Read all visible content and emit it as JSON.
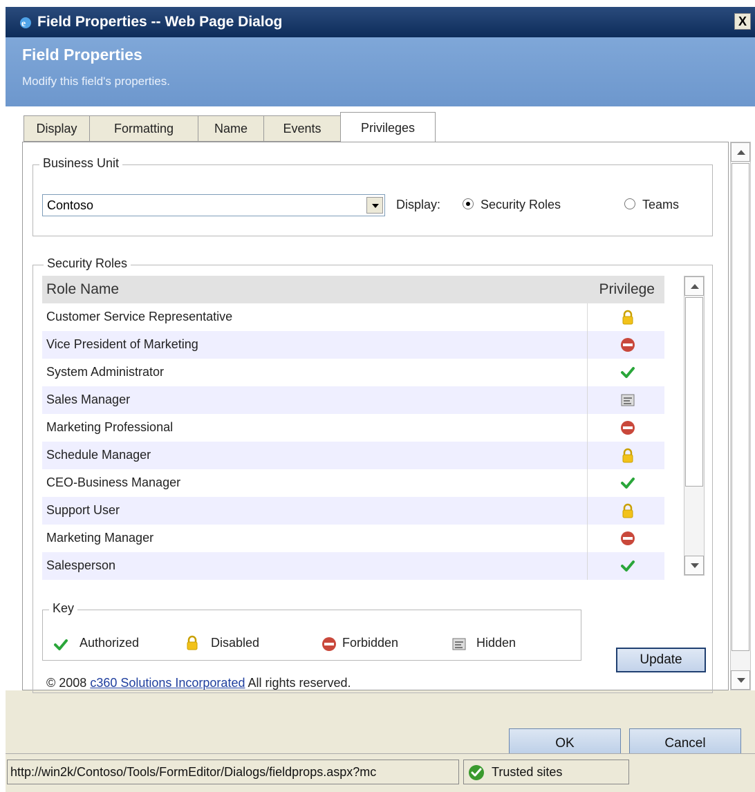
{
  "window": {
    "title": "Field Properties -- Web Page Dialog",
    "close_label": "X"
  },
  "header": {
    "title": "Field Properties",
    "subtitle": "Modify this field's properties."
  },
  "tabs": [
    {
      "label": "Display"
    },
    {
      "label": "Formatting"
    },
    {
      "label": "Name"
    },
    {
      "label": "Events"
    },
    {
      "label": "Privileges"
    }
  ],
  "active_tab": "Privileges",
  "business_unit": {
    "legend": "Business Unit",
    "selected": "Contoso",
    "display_label": "Display:",
    "radio_security_roles": "Security Roles",
    "radio_teams": "Teams",
    "selected_display": "Security Roles"
  },
  "security_roles": {
    "legend": "Security Roles",
    "columns": {
      "role_name": "Role Name",
      "privilege": "Privilege"
    },
    "rows": [
      {
        "name": "Customer Service Representative",
        "privilege": "disabled"
      },
      {
        "name": "Vice President of Marketing",
        "privilege": "forbidden"
      },
      {
        "name": "System Administrator",
        "privilege": "authorized"
      },
      {
        "name": "Sales Manager",
        "privilege": "hidden"
      },
      {
        "name": "Marketing Professional",
        "privilege": "forbidden"
      },
      {
        "name": "Schedule Manager",
        "privilege": "disabled"
      },
      {
        "name": "CEO-Business Manager",
        "privilege": "authorized"
      },
      {
        "name": "Support User",
        "privilege": "disabled"
      },
      {
        "name": "Marketing Manager",
        "privilege": "forbidden"
      },
      {
        "name": "Salesperson",
        "privilege": "authorized"
      }
    ]
  },
  "key": {
    "legend": "Key",
    "authorized": "Authorized",
    "disabled": "Disabled",
    "forbidden": "Forbidden",
    "hidden": "Hidden"
  },
  "update_label": "Update",
  "footer": {
    "copyright_prefix": "© 2008 ",
    "company_link": "c360 Solutions Incorporated",
    "copyright_suffix": " All rights reserved."
  },
  "buttons": {
    "ok": "OK",
    "cancel": "Cancel"
  },
  "status_bar": {
    "url": "http://win2k/Contoso/Tools/FormEditor/Dialogs/fieldprops.aspx?mc",
    "zone": "Trusted sites"
  },
  "colors": {
    "title_bar": "#0d2c5a",
    "header": "#7fa7d8",
    "authorized": "#2aa63a",
    "forbidden": "#c9483b",
    "disabled": "#f2c21a",
    "hidden": "#8a8a8a"
  },
  "icons": {
    "authorized": "checkmark-icon",
    "disabled": "padlock-icon",
    "forbidden": "no-entry-icon",
    "hidden": "hidden-field-icon"
  }
}
